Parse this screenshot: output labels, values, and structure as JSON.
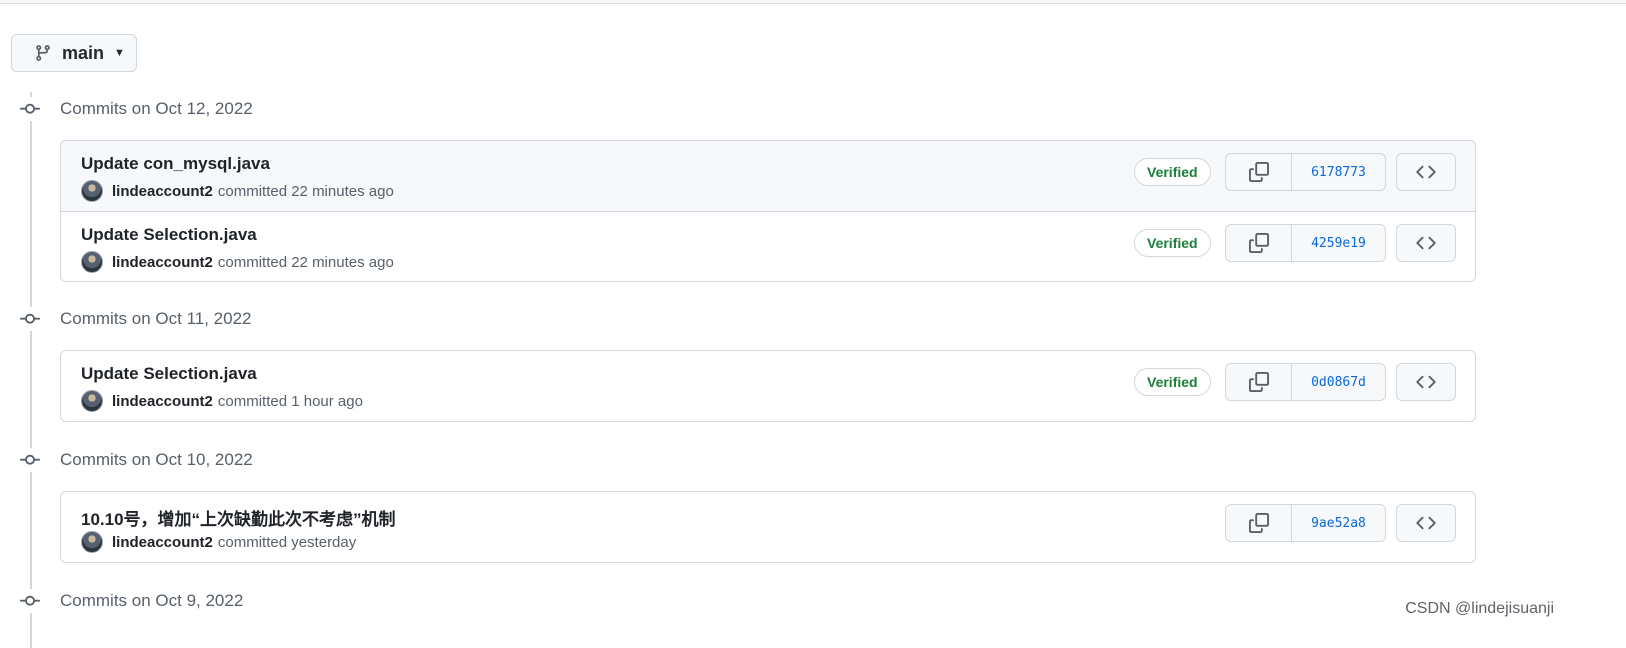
{
  "branch": {
    "name": "main",
    "icon": "git-branch-icon"
  },
  "groups": [
    {
      "heading": "Commits on Oct 12, 2022",
      "commits": [
        {
          "title": "Update con_mysql.java",
          "author": "lindeaccount2",
          "when": "committed 22 minutes ago",
          "verified": "Verified",
          "sha": "6178773"
        },
        {
          "title": "Update Selection.java",
          "author": "lindeaccount2",
          "when": "committed 22 minutes ago",
          "verified": "Verified",
          "sha": "4259e19"
        }
      ]
    },
    {
      "heading": "Commits on Oct 11, 2022",
      "commits": [
        {
          "title": "Update Selection.java",
          "author": "lindeaccount2",
          "when": "committed 1 hour ago",
          "verified": "Verified",
          "sha": "0d0867d"
        }
      ]
    },
    {
      "heading": "Commits on Oct 10, 2022",
      "commits": [
        {
          "title": "10.10号，增加“上次缺勤此次不考虑”机制",
          "author": "lindeaccount2",
          "when": "committed yesterday",
          "sha": "9ae52a8"
        }
      ]
    },
    {
      "heading": "Commits on Oct 9, 2022",
      "commits": []
    }
  ],
  "watermark": "CSDN @lindejisuanji",
  "colors": {
    "link": "#0969da",
    "verified": "#1a7f37",
    "muted": "#57606a",
    "border": "#d0d7de"
  }
}
